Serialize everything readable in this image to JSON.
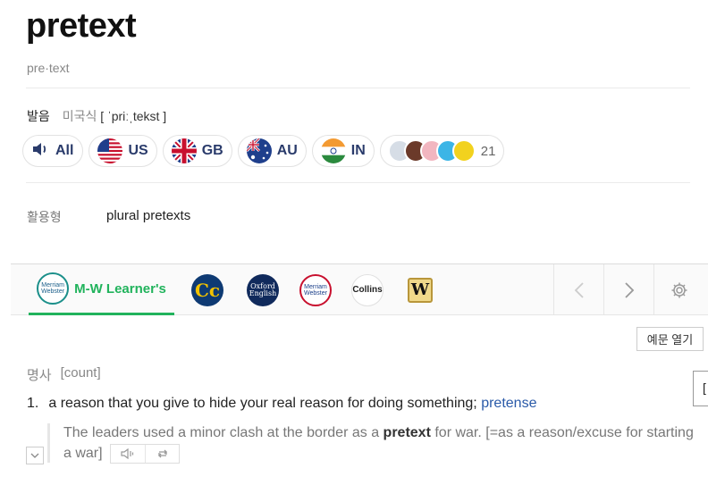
{
  "entry": {
    "word": "pretext",
    "syllables": "pre·text"
  },
  "pronunciation": {
    "label": "발음",
    "region": "미국식",
    "ipa": "[ ˈpriːˌtekst ]"
  },
  "audio_buttons": [
    {
      "label": "All",
      "icon": "speaker-icon"
    },
    {
      "label": "US",
      "icon": "us-flag-icon"
    },
    {
      "label": "GB",
      "icon": "uk-flag-icon"
    },
    {
      "label": "AU",
      "icon": "au-flag-icon"
    },
    {
      "label": "IN",
      "icon": "india-flag-icon"
    }
  ],
  "user_recordings": {
    "count": "21"
  },
  "inflection": {
    "label": "활용형",
    "value": "plural pretexts"
  },
  "dictionaries": {
    "active": "M-W Learner's",
    "active_logo_text": "Merriam Webster",
    "tabs": [
      {
        "name": "cambridge",
        "logo_text": "Cc"
      },
      {
        "name": "oxford",
        "logo_text": "Oxford English"
      },
      {
        "name": "merriam-webster",
        "logo_text": "Merriam Webster"
      },
      {
        "name": "collins",
        "logo_text": "Collins"
      },
      {
        "name": "wordsmyth",
        "logo_text": "W"
      }
    ]
  },
  "example_toggle": "예문 열기",
  "part_of_speech": {
    "pos": "명사",
    "grammar": "[count]"
  },
  "definition": {
    "number": "1.",
    "text": "a reason that you give to hide your real reason for doing something;",
    "synonym": "pretense"
  },
  "example": {
    "before": "The leaders used a minor clash at the border as a",
    "keyword": "pretext",
    "after": "for war. [=as a reason/excuse for starting a war]"
  },
  "edge_box_text": "["
}
